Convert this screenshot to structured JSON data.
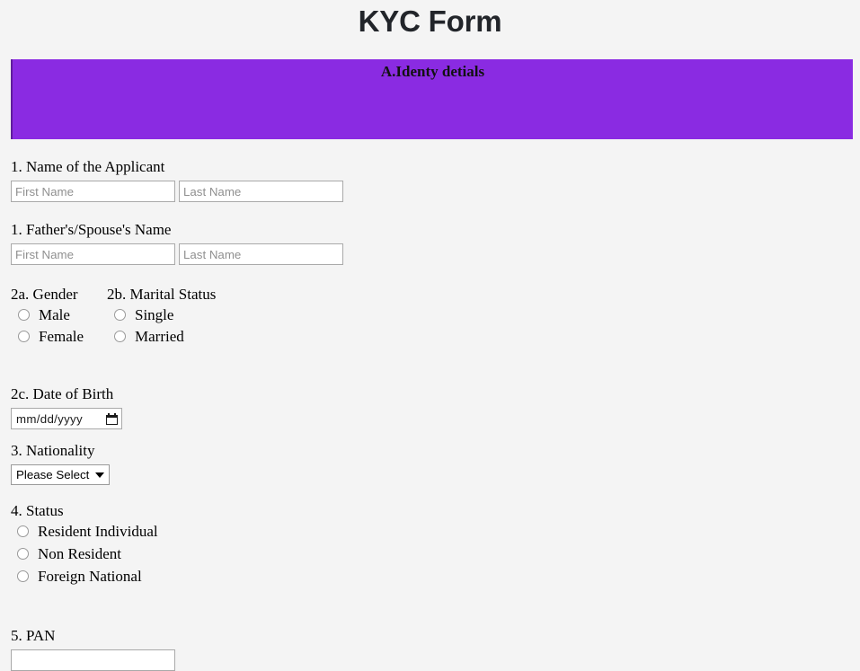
{
  "page": {
    "title": "KYC Form",
    "background_color": "#f4f4f4"
  },
  "section": {
    "banner_title": "A.Identy detials",
    "banner_color": "#8a2be2"
  },
  "fields": {
    "applicant_name": {
      "label": "1. Name of the Applicant",
      "first_name_placeholder": "First Name",
      "first_name_value": "",
      "last_name_placeholder": "Last Name",
      "last_name_value": ""
    },
    "father_spouse_name": {
      "label": "1. Father's/Spouse's Name",
      "first_name_placeholder": "First Name",
      "first_name_value": "",
      "last_name_placeholder": "Last Name",
      "last_name_value": ""
    },
    "gender": {
      "label": "2a. Gender",
      "options": [
        {
          "label": "Male",
          "selected": false
        },
        {
          "label": "Female",
          "selected": false
        }
      ]
    },
    "marital_status": {
      "label": "2b. Marital Status",
      "options": [
        {
          "label": "Single",
          "selected": false
        },
        {
          "label": "Married",
          "selected": false
        }
      ]
    },
    "date_of_birth": {
      "label": "2c. Date of Birth",
      "value": "",
      "placeholder": "mm/dd/yyyy",
      "icon": "calendar-icon"
    },
    "nationality": {
      "label": "3. Nationality",
      "selected_option": "Please Select",
      "arrow_icon": "chevron-down-icon"
    },
    "status": {
      "label": "4. Status",
      "options": [
        {
          "label": "Resident Individual",
          "selected": false
        },
        {
          "label": "Non Resident",
          "selected": false
        },
        {
          "label": "Foreign National",
          "selected": false
        }
      ]
    },
    "pan": {
      "label": "5. PAN",
      "value": "",
      "placeholder": ""
    }
  }
}
